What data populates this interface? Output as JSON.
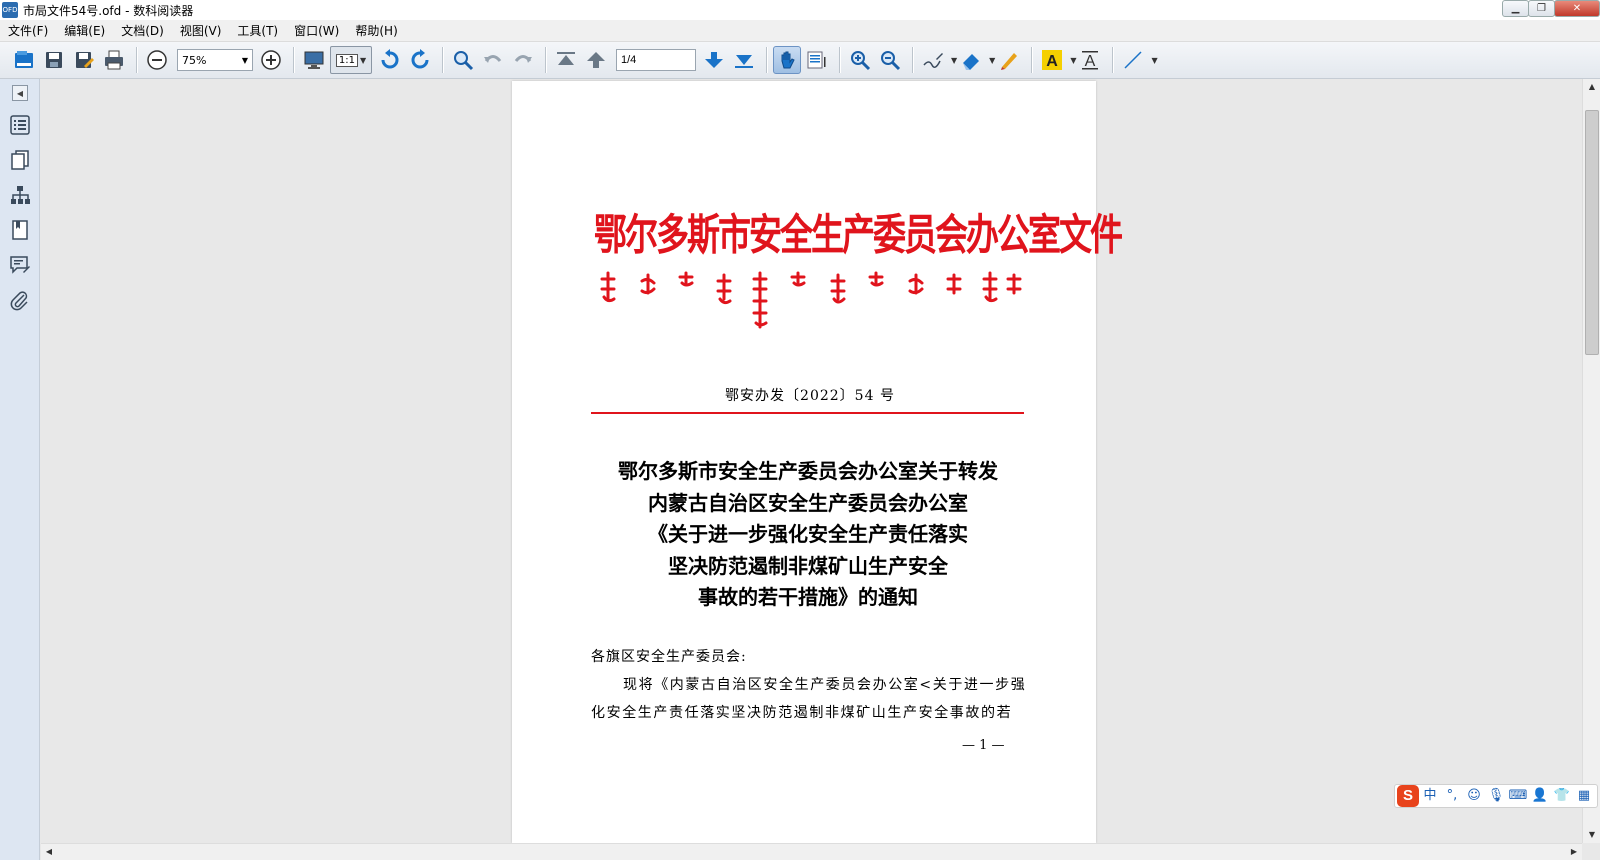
{
  "window": {
    "title": "市局文件54号.ofd - 数科阅读器",
    "app_icon_label": "OFD"
  },
  "menu": [
    "文件(F)",
    "编辑(E)",
    "文档(D)",
    "视图(V)",
    "工具(T)",
    "窗口(W)",
    "帮助(H)"
  ],
  "toolbar": {
    "zoom_value": "75%",
    "ratio_label": "1:1",
    "page_value": "1/4"
  },
  "document": {
    "header": "鄂尔多斯市安全生产委员会办公室文件",
    "doc_number": "鄂安办发〔2022〕54 号",
    "title_lines": [
      "鄂尔多斯市安全生产委员会办公室关于转发",
      "内蒙古自治区安全生产委员会办公室",
      "《关于进一步强化安全生产责任落实",
      "坚决防范遏制非煤矿山生产安全",
      "事故的若干措施》的通知"
    ],
    "salutation": "各旗区安全生产委员会:",
    "body_lines": [
      "现将《内蒙古自治区安全生产委员会办公室<关于进一步强",
      "化安全生产责任落实坚决防范遏制非煤矿山生产安全事故的若"
    ],
    "page_number": "— 1 —"
  },
  "ime": {
    "logo": "S",
    "mode": "中",
    "punct": "°,"
  },
  "colors": {
    "header_red": "#e0141c",
    "toolbar_blue": "#1a73c8",
    "ime_orange": "#e8431c"
  }
}
